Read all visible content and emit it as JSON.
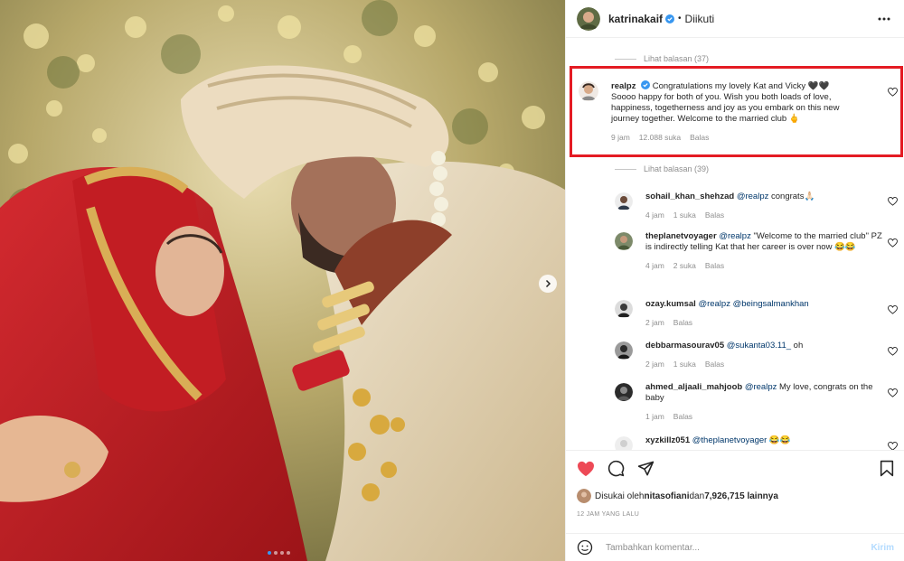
{
  "post": {
    "author": "katrinakaif",
    "follow_status": "Diikuti",
    "separator": "•"
  },
  "replies_toggles": [
    {
      "label": "Lihat balasan (37)"
    },
    {
      "label": "Lihat balasan (39)"
    }
  ],
  "main_comment": {
    "username": "realpz",
    "text": "Congratulations my lovely Kat and Vicky 🖤🖤 Soooo happy for both of you. Wish you both loads of love, happiness, togetherness and joy as you embark on this new journey together. Welcome to the married club 🖕",
    "time": "9 jam",
    "likes": "12.088 suka",
    "reply": "Balas"
  },
  "replies": [
    {
      "username": "sohail_khan_shehzad",
      "mention": "@realpz",
      "text": " congrats🙏🏻",
      "time": "4 jam",
      "likes": "1 suka",
      "reply": "Balas"
    },
    {
      "username": "theplanetvoyager",
      "mention": "@realpz",
      "text": " \"Welcome to the married club\" PZ is indirectly telling Kat that her career is over now 😂😂",
      "time": "4 jam",
      "likes": "2 suka",
      "reply": "Balas"
    },
    {
      "username": "ozay.kumsal",
      "mention": "@realpz @beingsalmankhan",
      "text": "",
      "time": "2 jam",
      "likes": "",
      "reply": "Balas"
    },
    {
      "username": "debbarmasourav05",
      "mention": "@sukanta03.11_",
      "text": " oh",
      "time": "2 jam",
      "likes": "1 suka",
      "reply": "Balas"
    },
    {
      "username": "ahmed_aljaali_mahjoob",
      "mention": "@realpz",
      "text": " My love, congrats on the baby",
      "time": "1 jam",
      "likes": "",
      "reply": "Balas"
    },
    {
      "username": "xyzkillz051",
      "mention": "@theplanetvoyager",
      "text": " 😂😂",
      "time": "",
      "likes": "",
      "reply": ""
    }
  ],
  "likes_line": {
    "prefix": "Disukai oleh ",
    "user": "nitasofiani",
    "middle": " dan ",
    "count": "7,926,715 lainnya"
  },
  "timestamp": "12 JAM YANG LALU",
  "add_comment": {
    "placeholder": "Tambahkan komentar...",
    "post_label": "Kirim"
  },
  "icons": {
    "like": "heart-filled-icon",
    "comment": "comment-icon",
    "share": "paper-plane-icon",
    "save": "bookmark-icon",
    "more": "more-horizontal-icon",
    "emoji": "smiley-icon"
  },
  "colors": {
    "like_red": "#ed4956",
    "verified_blue": "#3897f0",
    "highlight_red": "#e41b23",
    "link_blue": "#00376b"
  }
}
